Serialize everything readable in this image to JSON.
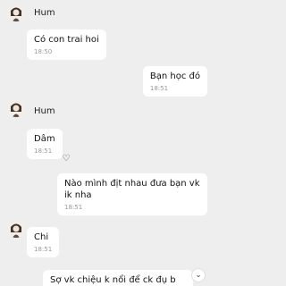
{
  "messages": [
    {
      "sender": "Hum",
      "text": "Có con trai hoi",
      "time": "18:50"
    },
    {
      "text": "Bạn học đó",
      "time": "18:51"
    },
    {
      "sender": "Hum",
      "text": "Dâm",
      "time": "18:51"
    },
    {
      "text": "Nào mình địt nhau đưa bạn vk ik nha",
      "time": "18:51"
    },
    {
      "sender": "Chi",
      "text": "Chi",
      "time": "18:51"
    },
    {
      "text": "Sợ vk chiệu k nổi để ck đụ b"
    }
  ],
  "icons": {
    "heart": "heart-icon",
    "chevron": "chevron-down-icon"
  },
  "glyphs": {
    "heart": "♡",
    "chevron": "⌄"
  }
}
